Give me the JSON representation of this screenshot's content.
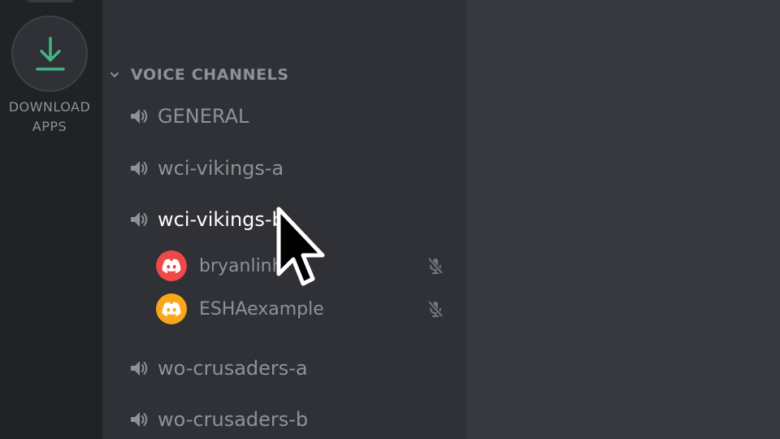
{
  "server_rail": {
    "download": {
      "icon": "download-icon",
      "label_line1": "DOWNLOAD",
      "label_line2": "APPS"
    }
  },
  "channel_list": {
    "category": {
      "label": "VOICE CHANNELS",
      "icon": "chevron-down-icon"
    },
    "voice_channels": [
      {
        "name": "GENERAL",
        "icon": "speaker-icon",
        "active": false
      },
      {
        "name": "wci-vikings-a",
        "icon": "speaker-icon",
        "active": false
      },
      {
        "name": "wci-vikings-b",
        "icon": "speaker-icon",
        "active": true
      },
      {
        "name": "wo-crusaders-a",
        "icon": "speaker-icon",
        "active": false
      },
      {
        "name": "wo-crusaders-b",
        "icon": "speaker-icon",
        "active": false
      }
    ],
    "connected_users": [
      {
        "name": "bryanlinh",
        "avatar_color": "#f04747",
        "status_icon": "mic-muted-icon"
      },
      {
        "name": "ESHAexample",
        "avatar_color": "#faa61a",
        "status_icon": "mic-muted-icon"
      }
    ]
  },
  "colors": {
    "rail_bg": "#202225",
    "channel_bg": "#2f3136",
    "main_bg": "#36393f",
    "download_green": "#43b581",
    "muted_text": "#8e9297",
    "active_text": "#ffffff"
  }
}
